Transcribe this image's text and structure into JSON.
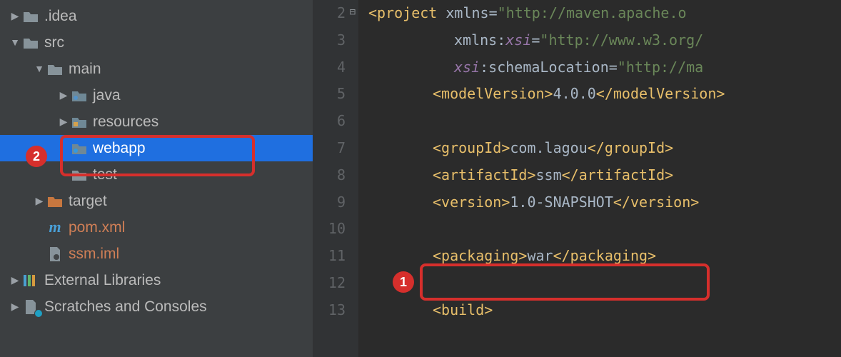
{
  "tree": {
    "idea": ".idea",
    "src": "src",
    "main": "main",
    "java": "java",
    "resources": "resources",
    "webapp": "webapp",
    "test": "test",
    "target": "target",
    "pom": "pom.xml",
    "iml": "ssm.iml",
    "ext_libs": "External Libraries",
    "scratches": "Scratches and Consoles"
  },
  "gutter": {
    "l2": "2",
    "l3": "3",
    "l4": "4",
    "l5": "5",
    "l6": "6",
    "l7": "7",
    "l8": "8",
    "l9": "9",
    "l10": "10",
    "l11": "11",
    "l12": "12",
    "l13": "13"
  },
  "code": {
    "project_tag": "<project",
    "xmlns_attr": " xmlns",
    "xmlns_val": "\"http://maven.apache.o",
    "xmlnsxsi_ns": "xmlns:",
    "xsi_word": "xsi",
    "xsi_val": "\"http://www.w3.org/",
    "schema_ns": "xsi",
    "schema_attr": ":schemaLocation",
    "schema_val": "\"http://ma",
    "modelVersion_open": "<modelVersion>",
    "modelVersion_text": "4.0.0",
    "modelVersion_close": "</modelVersion>",
    "groupId_open": "<groupId>",
    "groupId_text": "com.lagou",
    "groupId_close": "</groupId>",
    "artifactId_open": "<artifactId>",
    "artifactId_text": "ssm",
    "artifactId_close": "</artifactId>",
    "version_open": "<version>",
    "version_text": "1.0-SNAPSHOT",
    "version_close": "</version>",
    "packaging_open": "<packaging>",
    "packaging_text": "war",
    "packaging_close": "</packaging>",
    "build_open": "<build>",
    "eq": "="
  },
  "callouts": {
    "one": "1",
    "two": "2"
  }
}
